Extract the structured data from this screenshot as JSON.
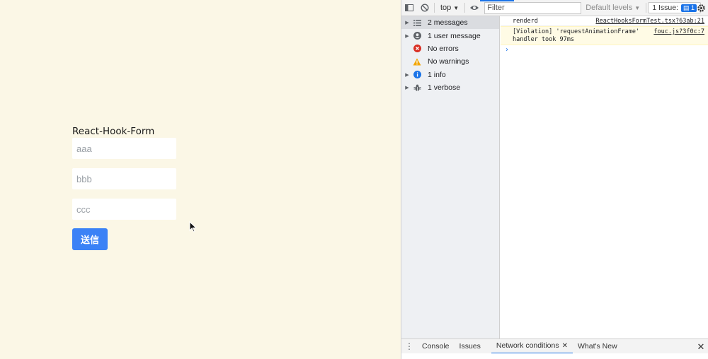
{
  "page": {
    "form_title": "React-Hook-Form",
    "inputs": [
      {
        "placeholder": "aaa",
        "value": ""
      },
      {
        "placeholder": "bbb",
        "value": ""
      },
      {
        "placeholder": "ccc",
        "value": ""
      }
    ],
    "submit_label": "送信"
  },
  "devtools": {
    "toolbar": {
      "context": "top",
      "filter_placeholder": "Filter",
      "levels_label": "Default levels",
      "issues_label": "1 Issue:",
      "issues_count": "1"
    },
    "sidebar": {
      "items": [
        {
          "label": "2 messages",
          "icon": "list-icon"
        },
        {
          "label": "1 user message",
          "icon": "user-icon"
        },
        {
          "label": "No errors",
          "icon": "error-icon"
        },
        {
          "label": "No warnings",
          "icon": "warning-icon"
        },
        {
          "label": "1 info",
          "icon": "info-icon"
        },
        {
          "label": "1 verbose",
          "icon": "bug-icon"
        }
      ]
    },
    "console": {
      "messages": [
        {
          "text": "renderd",
          "source": "ReactHooksFormTest.tsx?63ab:21"
        },
        {
          "text_line1": "[Violation] 'requestAnimationFrame'",
          "text_line2": "handler took 97ms",
          "source": "fouc.js?3f0c:7"
        }
      ],
      "prompt": "›"
    },
    "drawer": {
      "tabs": [
        "Console",
        "Issues",
        "Network conditions",
        "What's New"
      ],
      "active_tab": "Network conditions"
    }
  },
  "colors": {
    "page_bg": "#fbf7e6",
    "accent": "#1a73e8",
    "submit_bg": "#3b82f6"
  }
}
